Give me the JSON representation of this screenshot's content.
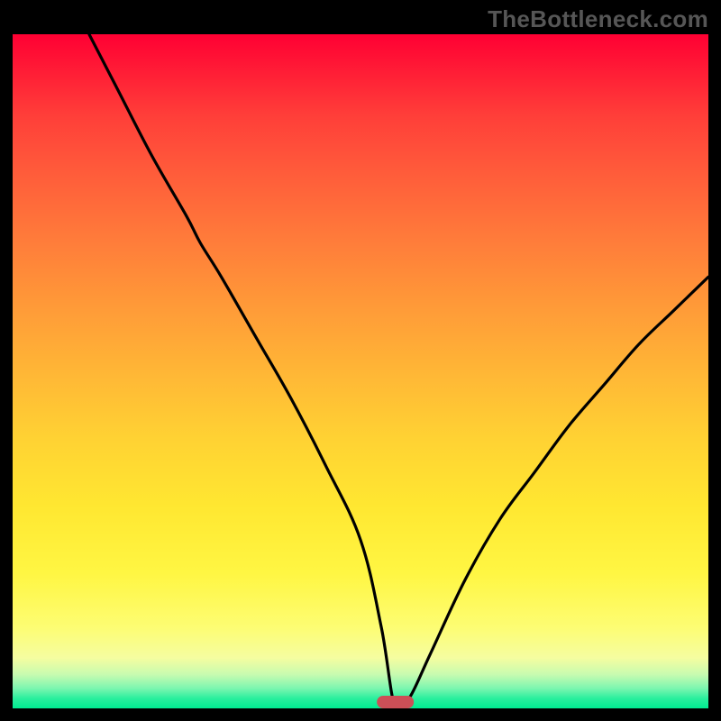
{
  "watermark": "TheBottleneck.com",
  "chart_data": {
    "type": "line",
    "title": "",
    "xlabel": "",
    "ylabel": "",
    "xlim": [
      0,
      100
    ],
    "ylim": [
      0,
      100
    ],
    "grid": false,
    "legend": false,
    "marker": {
      "x": 55,
      "width_pct": 5.4
    },
    "series": [
      {
        "name": "bottleneck-curve",
        "x": [
          11,
          15,
          20,
          25,
          27,
          30,
          35,
          40,
          45,
          50,
          53,
          55,
          57,
          60,
          65,
          70,
          75,
          80,
          85,
          90,
          95,
          100
        ],
        "y": [
          100,
          92,
          82,
          73,
          69,
          64,
          55,
          46,
          36,
          25,
          12,
          0,
          1.5,
          8,
          19,
          28,
          35,
          42,
          48,
          54,
          59,
          64
        ]
      }
    ],
    "gradient_stops": [
      {
        "pct": 0,
        "color": "#ff0033"
      },
      {
        "pct": 50,
        "color": "#ffb636"
      },
      {
        "pct": 88,
        "color": "#fdfd73"
      },
      {
        "pct": 100,
        "color": "#00ec91"
      }
    ]
  }
}
